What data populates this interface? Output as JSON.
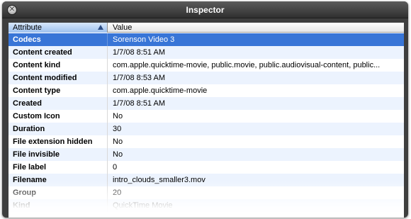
{
  "window": {
    "title": "Inspector",
    "close_symbol": "✕"
  },
  "table": {
    "columns": {
      "attribute": "Attribute",
      "value": "Value"
    },
    "sort_icon": "sort-ascending-icon",
    "selected_row_color": "#3875d7",
    "alt_row_color": "#ecf3fe",
    "rows": [
      {
        "attribute": "Codecs",
        "value": "Sorenson Video 3"
      },
      {
        "attribute": "Content created",
        "value": "1/7/08 8:51 AM"
      },
      {
        "attribute": "Content kind",
        "value": "com.apple.quicktime-movie, public.movie, public.audiovisual-content, public..."
      },
      {
        "attribute": "Content modified",
        "value": "1/7/08 8:53 AM"
      },
      {
        "attribute": "Content type",
        "value": "com.apple.quicktime-movie"
      },
      {
        "attribute": "Created",
        "value": "1/7/08 8:51 AM"
      },
      {
        "attribute": "Custom Icon",
        "value": "No"
      },
      {
        "attribute": "Duration",
        "value": "30"
      },
      {
        "attribute": "File extension hidden",
        "value": "No"
      },
      {
        "attribute": "File invisible",
        "value": "No"
      },
      {
        "attribute": "File label",
        "value": "0"
      },
      {
        "attribute": "Filename",
        "value": "intro_clouds_smaller3.mov"
      },
      {
        "attribute": "Group",
        "value": "20"
      },
      {
        "attribute": "Kind",
        "value": "QuickTime Movie"
      }
    ]
  }
}
